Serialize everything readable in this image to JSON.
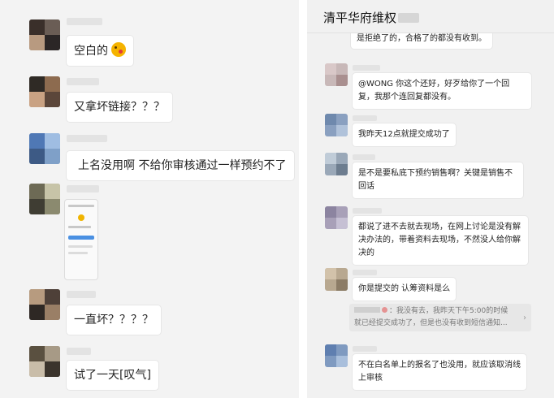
{
  "left_chat": {
    "messages": [
      {
        "text": "空白的",
        "emoji": "kiss-emoji"
      },
      {
        "text": "又拿坏链接？？？"
      },
      {
        "text": "上名没用啊 不给你审核通过一样预约不了"
      },
      {
        "image": "phone-screenshot"
      },
      {
        "text": "一直坏？？？？"
      },
      {
        "text": "试了一天[叹气]"
      }
    ]
  },
  "right_chat": {
    "title": "清平华府维权",
    "messages": [
      {
        "text": "是拒绝了的，合格了的都没有收到。"
      },
      {
        "text": "@WONG 你这个还好，好歹给你了一个回复，我那个连回复都没有。"
      },
      {
        "text": "我昨天12点就提交成功了"
      },
      {
        "text": "是不是要私底下预约销售啊？关键是销售不回话"
      },
      {
        "text": "都说了进不去就去现场，在网上讨论是没有解决办法的，带着资料去现场，不然没人给你解决的"
      },
      {
        "text": "你是提交的 认筹资料是么"
      },
      {
        "text": "不在白名单上的报名了也没用，就应该取消线上审核"
      }
    ],
    "quote": {
      "line1": "：我没有去，我昨天下午5:00的时候",
      "line2": "就已经提交成功了，但是也没有收到短信通知...",
      "arrow": "›"
    }
  },
  "colors": {
    "left_bg": "#f3f3f3",
    "right_bg": "#f1f1f1",
    "bubble": "#ffffff",
    "quote_bg": "#e7e7e7"
  }
}
